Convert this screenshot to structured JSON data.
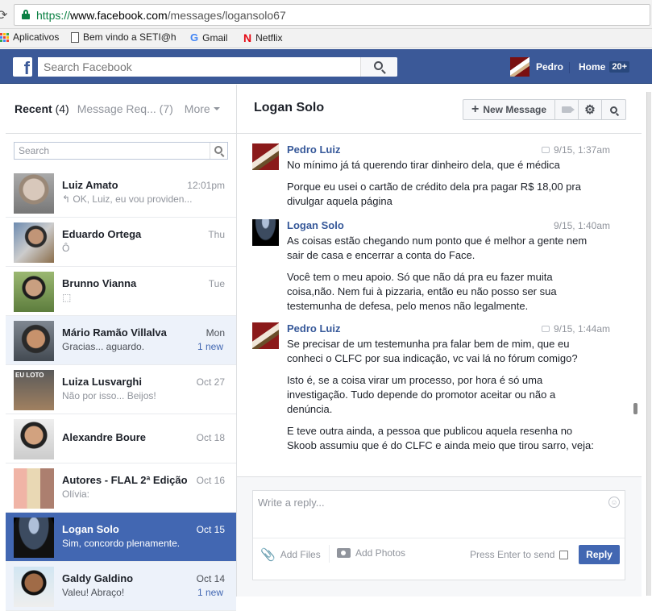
{
  "browser": {
    "url_scheme": "https://",
    "url_host": "www.facebook.com",
    "url_path": "/messages/logansolo67",
    "bookmarks": [
      {
        "label": "Aplicativos",
        "icon": "apps-grid-icon"
      },
      {
        "label": "Bem vindo a SETI@hc",
        "icon": "page-icon"
      },
      {
        "label": "Gmail",
        "icon": "google-icon"
      },
      {
        "label": "Netflix",
        "icon": "netflix-icon"
      }
    ]
  },
  "fb": {
    "logo": "f",
    "search_placeholder": "Search Facebook",
    "user_name": "Pedro",
    "home_label": "Home",
    "home_badge": "20+"
  },
  "sidebar": {
    "tab_recent": "Recent",
    "tab_recent_count": "(4)",
    "tab_requests": "Message Req...",
    "tab_requests_count": "(7)",
    "tab_more": "More",
    "search_placeholder": "Search",
    "threads": [
      {
        "name": "Luiz Amato",
        "snippet": "↰ OK, Luiz, eu vou providen...",
        "time": "12:01pm",
        "new": "",
        "state": "read",
        "avatar": "av1"
      },
      {
        "name": "Eduardo Ortega",
        "snippet": "Ô",
        "time": "Thu",
        "new": "",
        "state": "read",
        "avatar": "av2"
      },
      {
        "name": "Brunno Vianna",
        "snippet": "⬚",
        "time": "Tue",
        "new": "",
        "state": "read",
        "avatar": "av3"
      },
      {
        "name": "Mário Ramão Villalva",
        "snippet": "Gracias... aguardo.",
        "time": "Mon",
        "new": "1 new",
        "state": "unread",
        "avatar": "av4"
      },
      {
        "name": "Luiza Lusvarghi",
        "snippet": "Não por isso... Beijos!",
        "time": "Oct 27",
        "new": "",
        "state": "read",
        "avatar": "av5"
      },
      {
        "name": "Alexandre Boure",
        "snippet": "",
        "time": "Oct 18",
        "new": "",
        "state": "read",
        "avatar": "av6"
      },
      {
        "name": "Autores - FLAL 2ª Edição",
        "snippet": "Olívia:",
        "time": "Oct 16",
        "new": "",
        "state": "read",
        "avatar": "av7"
      },
      {
        "name": "Logan Solo",
        "snippet": "Sim, concordo plenamente.",
        "time": "Oct 15",
        "new": "",
        "state": "selected",
        "avatar": "av8"
      },
      {
        "name": "Galdy Galdino",
        "snippet": "Valeu! Abraço!",
        "time": "Oct 14",
        "new": "1 new",
        "state": "unread",
        "avatar": "av9"
      }
    ]
  },
  "conversation": {
    "title": "Logan Solo",
    "new_message_label": "New Message",
    "messages": [
      {
        "sender": "Pedro Luiz",
        "time": "9/15, 1:37am",
        "paragraphs": [
          "No mínimo já tá querendo tirar dinheiro dela, que é médica",
          "Porque eu usei o cartão de crédito dela pra pagar R$ 18,00 pra divulgar aquela página"
        ]
      },
      {
        "sender": "Logan Solo",
        "time": "9/15, 1:40am",
        "paragraphs": [
          "As coisas estão chegando num ponto que é melhor a gente nem sair de casa e encerrar a conta do Face.",
          "Você tem o meu apoio. Só que não dá pra eu fazer muita coisa,não. Nem fui à pizzaria, então eu não posso ser sua testemunha de defesa, pelo menos não legalmente."
        ]
      },
      {
        "sender": "Pedro Luiz",
        "time": "9/15, 1:44am",
        "paragraphs": [
          "Se precisar de um testemunha pra falar bem de mim, que eu conheci o CLFC por sua indicação, vc vai lá no fórum comigo?",
          "Isto é, se a coisa virar um processo, por hora é só uma investigação. Tudo depende do promotor aceitar ou não a denúncia.",
          "E teve outra ainda, a pessoa que publicou aquela resenha no Skoob assumiu que é do CLFC e ainda meio que tirou sarro, veja:"
        ]
      }
    ]
  },
  "composer": {
    "placeholder": "Write a reply...",
    "add_files": "Add Files",
    "add_photos": "Add Photos",
    "press_enter": "Press Enter to send",
    "reply_button": "Reply"
  },
  "avatar_text": {
    "pedro_logo": "PEDROOM LANNE",
    "luiza_overlay": "EU LOTO"
  }
}
